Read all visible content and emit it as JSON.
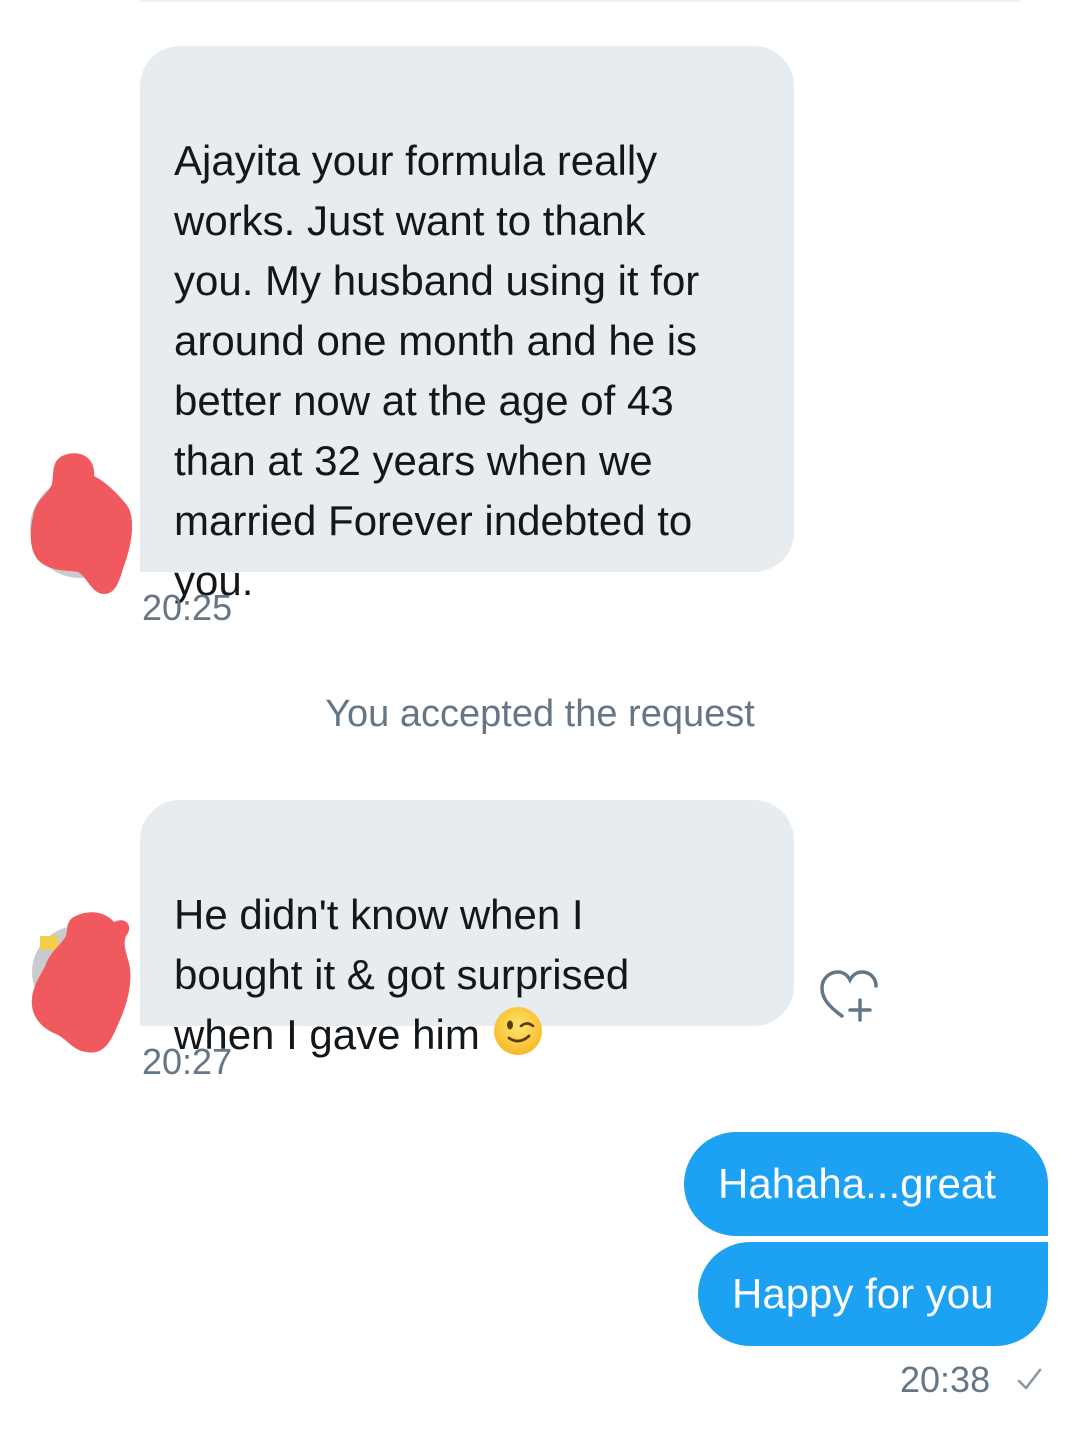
{
  "conversation": {
    "messages": [
      {
        "direction": "incoming",
        "text": "Ajayita your formula really\nworks. Just want to thank\nyou. My husband using it for\naround one month and he is\nbetter now at the age of 43\nthan at 32 years when we\nmarried  Forever indebted to\nyou.",
        "time": "20:25"
      },
      {
        "direction": "system",
        "text": "You accepted the request"
      },
      {
        "direction": "incoming",
        "text": "He didn't know when I\nbought it & got surprised\nwhen I gave him",
        "emoji": "winking-face-emoji",
        "time": "20:27"
      },
      {
        "direction": "outgoing",
        "text": "Hahaha...great"
      },
      {
        "direction": "outgoing",
        "text": "Happy for you",
        "time": "20:38",
        "status": "sent-checkmark"
      }
    ]
  },
  "icons": {
    "react": "heart-plus-icon",
    "status": "checkmark-icon",
    "avatar": "redacted-avatar"
  },
  "colors": {
    "incoming_bubble": "#e6ecf0",
    "outgoing_bubble": "#1da1f2",
    "meta_text": "#657786",
    "redaction": "#f05a5f"
  }
}
